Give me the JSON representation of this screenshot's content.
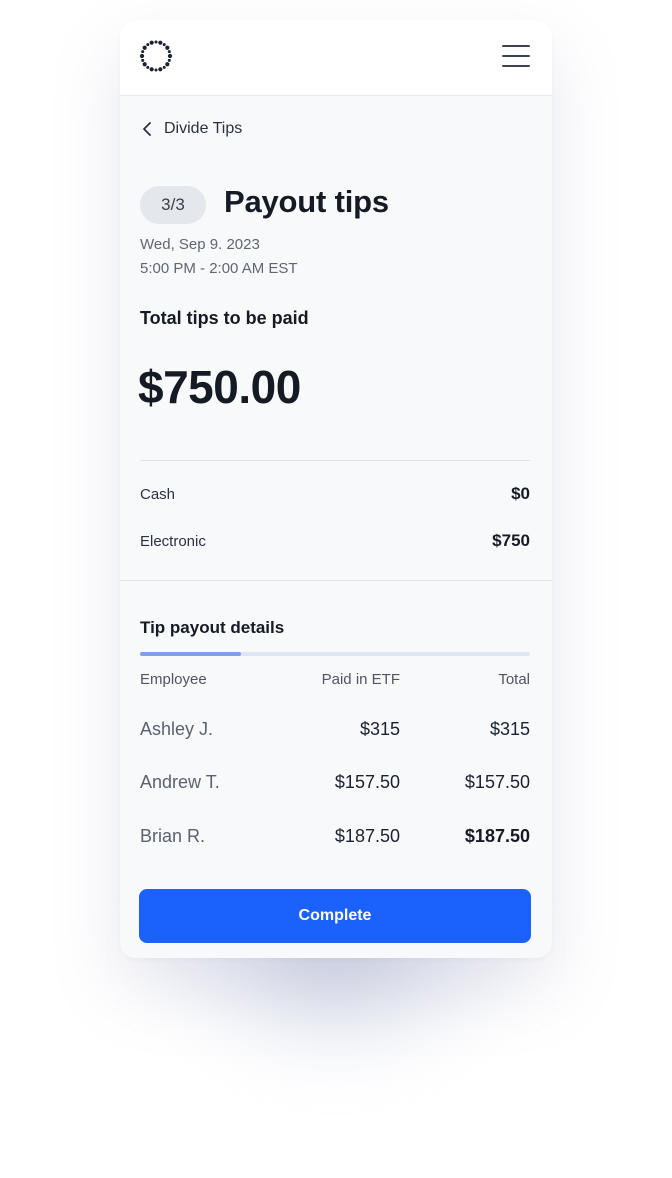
{
  "header": {
    "logo_icon": "dotted-ring-logo-icon",
    "menu_icon": "hamburger-menu-icon"
  },
  "nav": {
    "back_label": "Divide Tips",
    "back_icon": "chevron-left-icon"
  },
  "page": {
    "step": "3/3",
    "title": "Payout tips",
    "date": "Wed, Sep 9. 2023",
    "time_range": "5:00 PM - 2:00 AM EST"
  },
  "summary": {
    "total_label": "Total tips to be paid",
    "total_amount": "$750.00",
    "rows": [
      {
        "label": "Cash",
        "value": "$0"
      },
      {
        "label": "Electronic",
        "value": "$750"
      }
    ]
  },
  "details": {
    "title": "Tip payout details",
    "progress_fraction": 0.26,
    "columns": [
      "Employee",
      "Paid in ETF",
      "Total"
    ],
    "rows": [
      {
        "employee": "Ashley J.",
        "paid_etf": "$315",
        "total": "$315"
      },
      {
        "employee": "Andrew T.",
        "paid_etf": "$157.50",
        "total": "$157.50"
      },
      {
        "employee": "Brian R.",
        "paid_etf": "$187.50",
        "total": "$187.50"
      }
    ]
  },
  "actions": {
    "complete_label": "Complete"
  },
  "colors": {
    "accent": "#1a62fb",
    "progress": "#7f9fe8"
  }
}
